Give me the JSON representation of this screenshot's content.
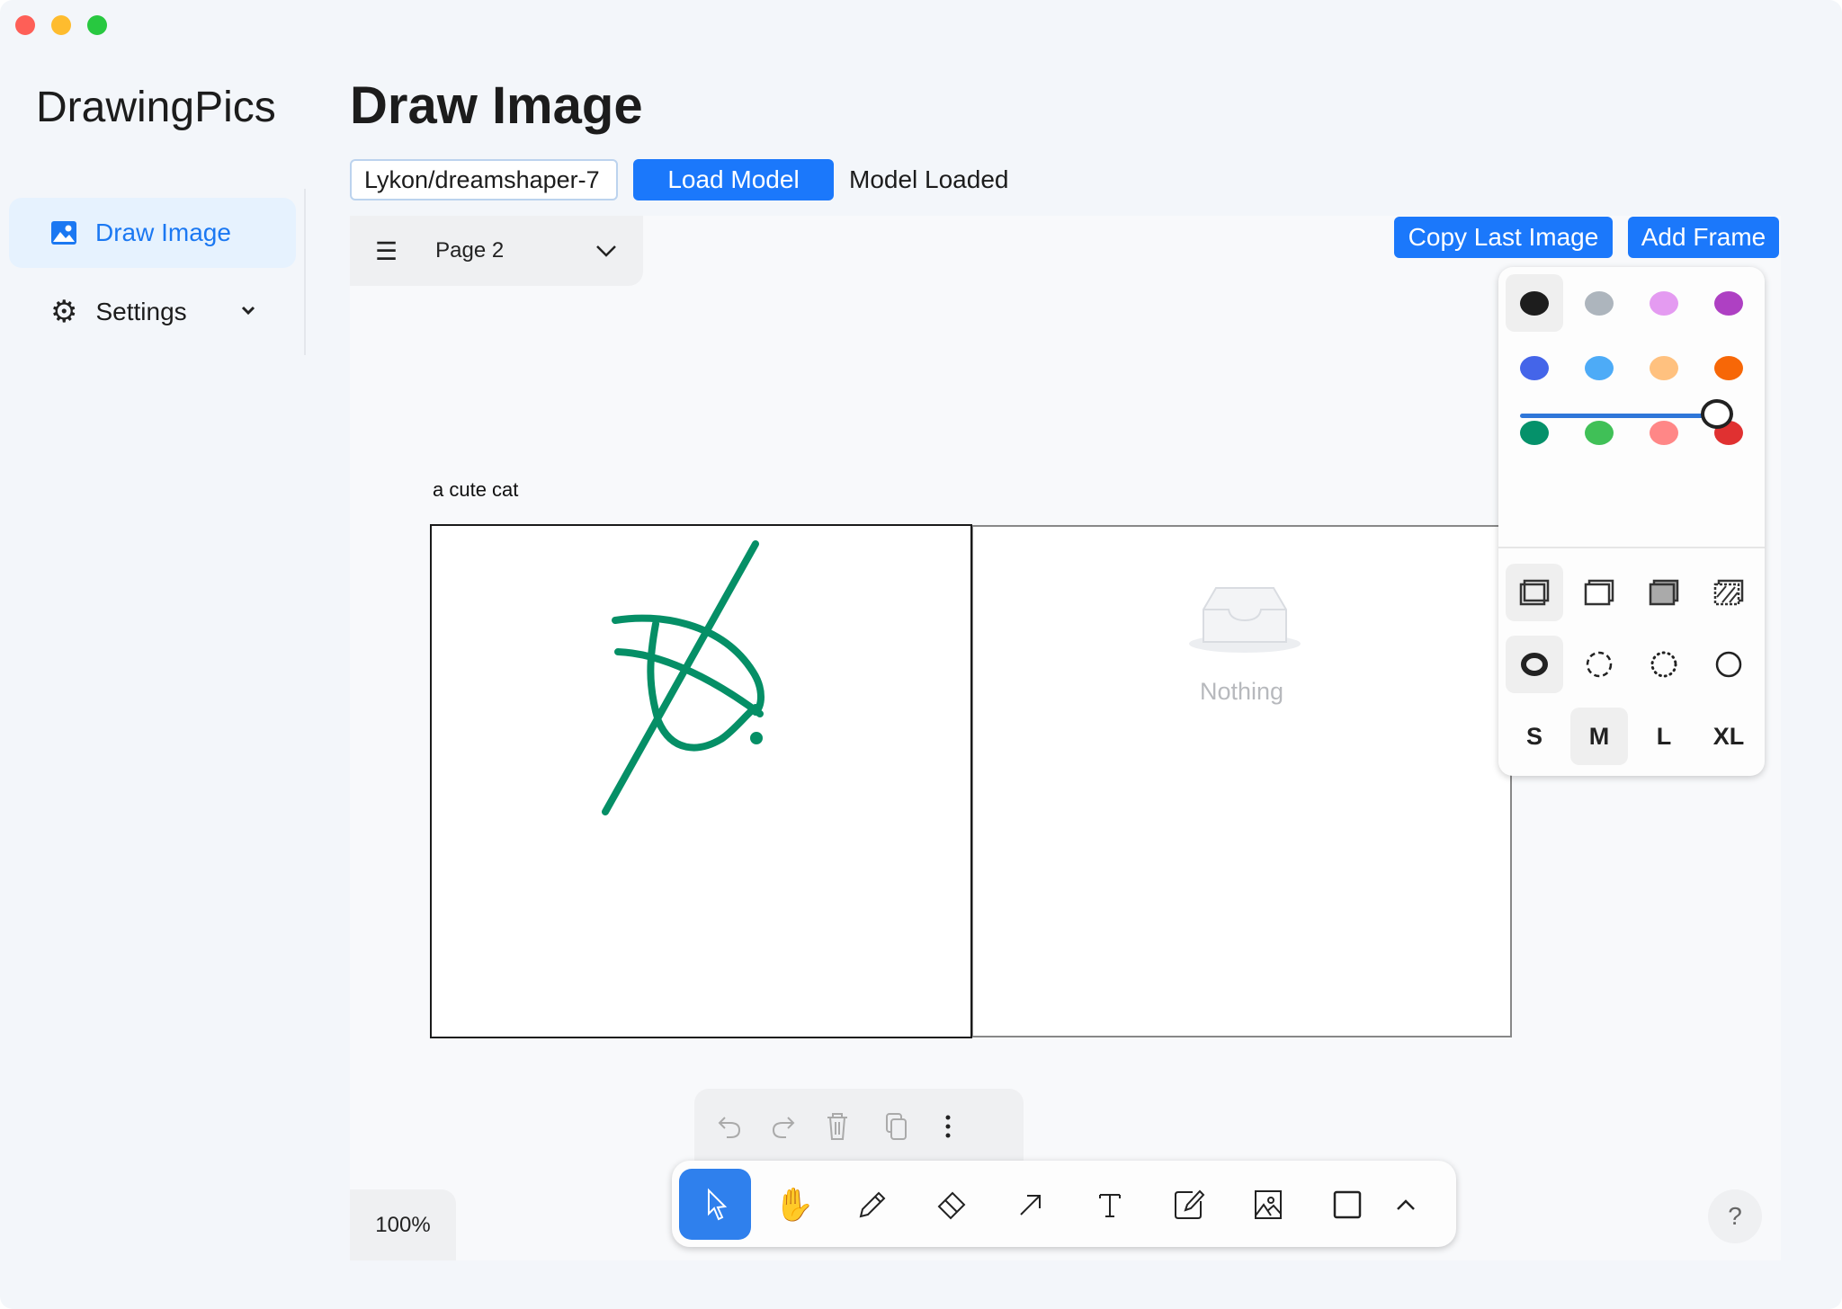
{
  "app": {
    "name": "DrawingPics"
  },
  "sidebar": {
    "items": [
      {
        "label": "Draw Image",
        "icon": "image-icon",
        "active": true
      },
      {
        "label": "Settings",
        "icon": "gear-icon"
      }
    ]
  },
  "header": {
    "title": "Draw Image"
  },
  "model": {
    "input_value": "Lykon/dreamshaper-7",
    "load_label": "Load Model",
    "status": "Model Loaded"
  },
  "canvas": {
    "page_name": "Page 2",
    "copy_last_label": "Copy Last Image",
    "add_frame_label": "Add Frame",
    "frame_label": "a cute cat",
    "empty_label": "Nothing",
    "zoom": "100%",
    "help": "?",
    "stroke_color": "#058f66"
  },
  "style_panel": {
    "colors": [
      "#1d1d1d",
      "#adb5bd",
      "#e49bf1",
      "#ae40c3",
      "#4465e9",
      "#4dabf7",
      "#ffc17f",
      "#f76707",
      "#05916a",
      "#40c057",
      "#ff8787",
      "#e03131"
    ],
    "selected_color": "#1d1d1d",
    "opacity": 1.0,
    "sizes": [
      "S",
      "M",
      "L",
      "XL"
    ],
    "selected_size": "M",
    "accent": "#1b78fb"
  }
}
